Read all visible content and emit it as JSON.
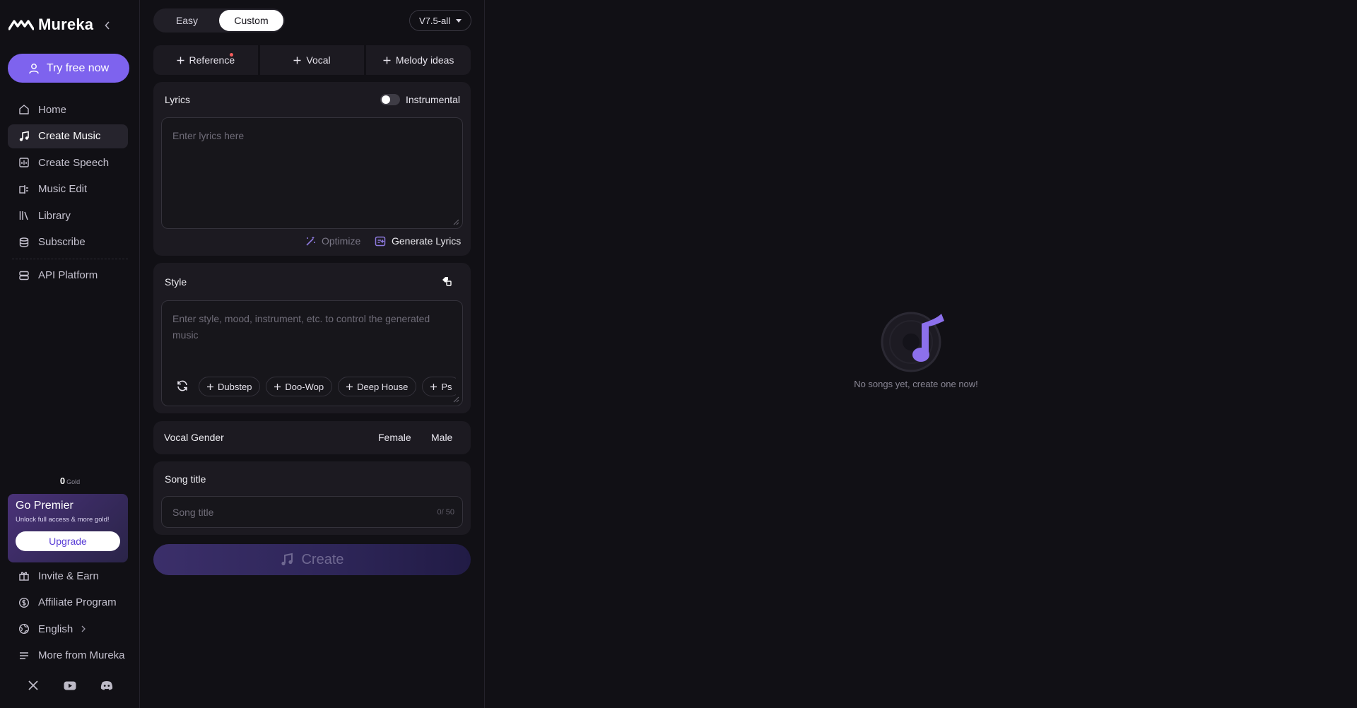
{
  "brand": {
    "name": "Mureka"
  },
  "sidebar": {
    "try_label": "Try free now",
    "nav": [
      {
        "label": "Home",
        "icon": "home-icon"
      },
      {
        "label": "Create Music",
        "icon": "music-note-icon",
        "active": true
      },
      {
        "label": "Create Speech",
        "icon": "speech-icon"
      },
      {
        "label": "Music Edit",
        "icon": "music-edit-icon"
      },
      {
        "label": "Library",
        "icon": "library-icon"
      },
      {
        "label": "Subscribe",
        "icon": "subscribe-icon"
      },
      {
        "label": "API Platform",
        "icon": "api-icon"
      }
    ],
    "gold_amount": "0",
    "gold_unit": "Gold",
    "premier": {
      "title": "Go Premier",
      "subtitle": "Unlock full access & more gold!",
      "button": "Upgrade"
    },
    "bottom": [
      {
        "label": "Invite & Earn",
        "icon": "gift-icon"
      },
      {
        "label": "Affiliate Program",
        "icon": "dollar-icon"
      },
      {
        "label": "English",
        "icon": "globe-icon"
      },
      {
        "label": "More from Mureka",
        "icon": "menu-icon"
      }
    ],
    "social": [
      "x-icon",
      "youtube-icon",
      "discord-icon"
    ]
  },
  "form": {
    "modes": [
      "Easy",
      "Custom"
    ],
    "active_mode": "Custom",
    "version": "V7.5-all",
    "add_buttons": [
      "Reference",
      "Vocal",
      "Melody ideas"
    ],
    "lyrics": {
      "label": "Lyrics",
      "instrumental_label": "Instrumental",
      "instrumental_on": false,
      "placeholder": "Enter lyrics here",
      "optimize": "Optimize",
      "generate": "Generate Lyrics"
    },
    "style": {
      "label": "Style",
      "placeholder": "Enter style, mood, instrument, etc. to control the generated music",
      "chips": [
        "Dubstep",
        "Doo-Wop",
        "Deep House",
        "Ps"
      ]
    },
    "vocal_gender": {
      "label": "Vocal Gender",
      "options": [
        "Female",
        "Male"
      ]
    },
    "song_title": {
      "label": "Song title",
      "placeholder": "Song title",
      "counter": "0/ 50"
    },
    "create_label": "Create"
  },
  "empty_state": {
    "text": "No songs yet, create one now!"
  },
  "colors": {
    "accent": "#7e63ee",
    "background": "#111015",
    "card": "#1c1a21"
  }
}
